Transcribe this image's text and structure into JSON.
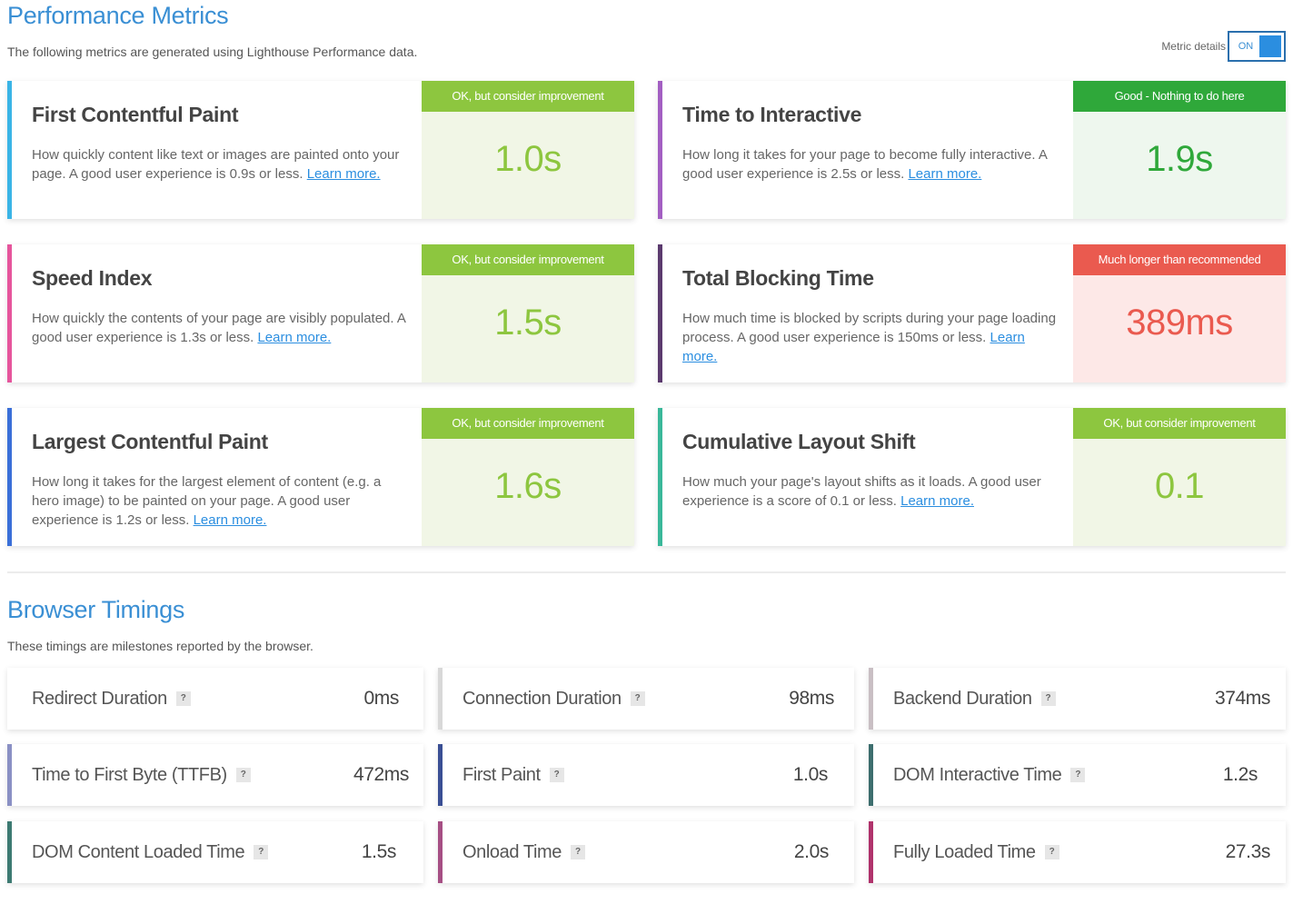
{
  "performance": {
    "title": "Performance Metrics",
    "subtitle": "The following metrics are generated using Lighthouse Performance data.",
    "toggle": {
      "label": "Metric details",
      "state": "ON"
    },
    "learn_more": "Learn more.",
    "metrics": [
      {
        "title": "First Contentful Paint",
        "desc_pre": "How quickly content like text or images are painted onto your page. A good user experience is 0.9s or less. ",
        "grade": "OK, but consider improvement",
        "value": "1.0s",
        "accent": "#3ab4e6",
        "badge_color": "#8dc63f",
        "bg_color": "#f1f6e6",
        "value_color": "#8dc63f"
      },
      {
        "title": "Time to Interactive",
        "desc_pre": "How long it takes for your page to become fully interactive. A good user experience is 2.5s or less. ",
        "grade": "Good - Nothing to do here",
        "value": "1.9s",
        "accent": "#a35fc2",
        "badge_color": "#2fa83a",
        "bg_color": "#eef7ee",
        "value_color": "#2fa83a"
      },
      {
        "title": "Speed Index",
        "desc_pre": "How quickly the contents of your page are visibly populated. A good user experience is 1.3s or less. ",
        "grade": "OK, but consider improvement",
        "value": "1.5s",
        "accent": "#e6559c",
        "badge_color": "#8dc63f",
        "bg_color": "#f1f6e6",
        "value_color": "#8dc63f"
      },
      {
        "title": "Total Blocking Time",
        "desc_pre": "How much time is blocked by scripts during your page loading process. A good user experience is 150ms or less. ",
        "grade": "Much longer than recommended",
        "value": "389ms",
        "accent": "#5b3a6e",
        "badge_color": "#ea5a4f",
        "bg_color": "#fde8e7",
        "value_color": "#ea5a4f"
      },
      {
        "title": "Largest Contentful Paint",
        "desc_pre": "How long it takes for the largest element of content (e.g. a hero image) to be painted on your page. A good user experience is 1.2s or less. ",
        "grade": "OK, but consider improvement",
        "value": "1.6s",
        "accent": "#3a6fd8",
        "badge_color": "#8dc63f",
        "bg_color": "#f1f6e6",
        "value_color": "#8dc63f"
      },
      {
        "title": "Cumulative Layout Shift",
        "desc_pre": "How much your page's layout shifts as it loads. A good user experience is a score of 0.1 or less. ",
        "grade": "OK, but consider improvement",
        "value": "0.1",
        "accent": "#3ab89a",
        "badge_color": "#8dc63f",
        "bg_color": "#f1f6e6",
        "value_color": "#8dc63f"
      }
    ]
  },
  "browser": {
    "title": "Browser Timings",
    "subtitle": "These timings are milestones reported by the browser.",
    "help_glyph": "?",
    "timings": [
      {
        "label": "Redirect Duration",
        "value": "0ms",
        "accent": "#ffffff"
      },
      {
        "label": "Connection Duration",
        "value": "98ms",
        "accent": "#d8d8d8"
      },
      {
        "label": "Backend Duration",
        "value": "374ms",
        "accent": "#c9bfc4"
      },
      {
        "label": "Time to First Byte (TTFB)",
        "value": "472ms",
        "accent": "#8a90c4"
      },
      {
        "label": "First Paint",
        "value": "1.0s",
        "accent": "#3a4f94"
      },
      {
        "label": "DOM Interactive Time",
        "value": "1.2s",
        "accent": "#3d6e6e"
      },
      {
        "label": "DOM Content Loaded Time",
        "value": "1.5s",
        "accent": "#3d7a72"
      },
      {
        "label": "Onload Time",
        "value": "2.0s",
        "accent": "#a64f84"
      },
      {
        "label": "Fully Loaded Time",
        "value": "27.3s",
        "accent": "#b0336c"
      }
    ]
  }
}
